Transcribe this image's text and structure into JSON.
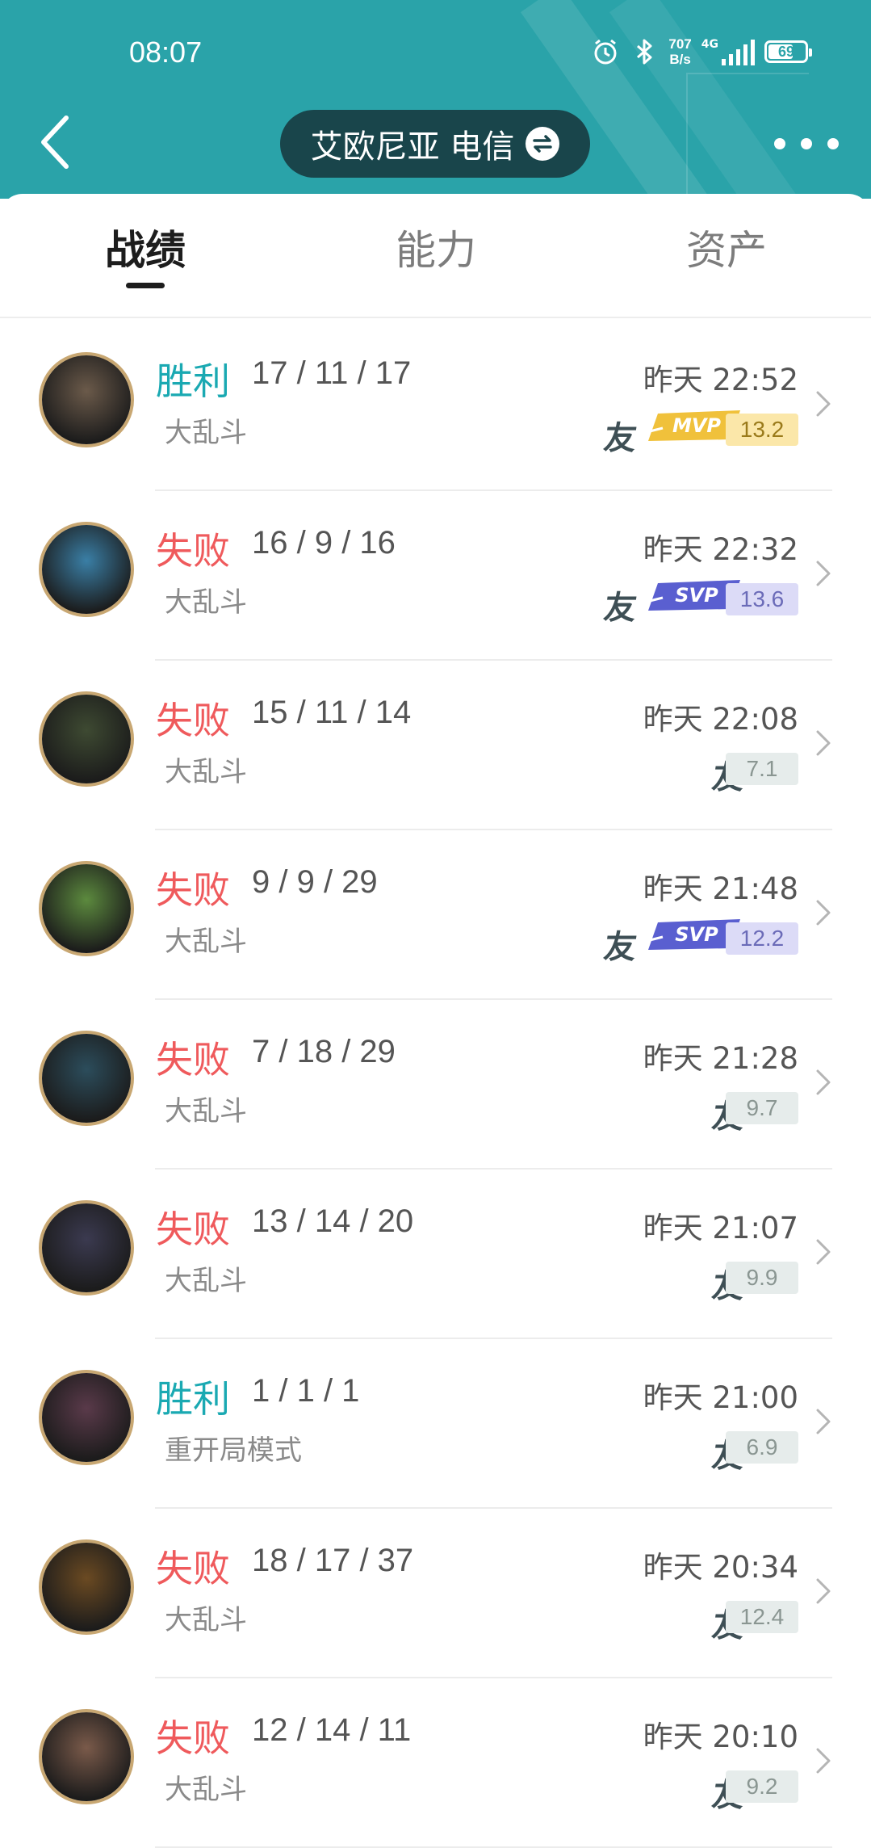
{
  "status_bar": {
    "time": "08:07",
    "speed_top": "707",
    "speed_bottom": "B/s",
    "network": "4G",
    "battery": "69",
    "battery_level": 0.69
  },
  "header": {
    "server_name": "艾欧尼亚 电信",
    "colors": {
      "bg": "#2aa3a9",
      "pill": "#19454b"
    }
  },
  "tabs": [
    {
      "label": "战绩",
      "active": true
    },
    {
      "label": "能力",
      "active": false
    },
    {
      "label": "资产",
      "active": false
    }
  ],
  "matches": [
    {
      "result": "胜利",
      "outcome": "win",
      "kda": "17 / 11 / 17",
      "time": "昨天 22:52",
      "mode": "大乱斗",
      "friend": "友",
      "badge": "MVP",
      "score": "13.2",
      "avatar_color": "#6b5a4a"
    },
    {
      "result": "失败",
      "outcome": "loss",
      "kda": "16 / 9 / 16",
      "time": "昨天 22:32",
      "mode": "大乱斗",
      "friend": "友",
      "badge": "SVP",
      "score": "13.6",
      "avatar_color": "#3a7fa6"
    },
    {
      "result": "失败",
      "outcome": "loss",
      "kda": "15 / 11 / 14",
      "time": "昨天 22:08",
      "mode": "大乱斗",
      "friend": "友",
      "badge": "",
      "score": "7.1",
      "avatar_color": "#3e4a32"
    },
    {
      "result": "失败",
      "outcome": "loss",
      "kda": "9 / 9 / 29",
      "time": "昨天 21:48",
      "mode": "大乱斗",
      "friend": "友",
      "badge": "SVP",
      "score": "12.2",
      "avatar_color": "#5c8a3e"
    },
    {
      "result": "失败",
      "outcome": "loss",
      "kda": "7 / 18 / 29",
      "time": "昨天 21:28",
      "mode": "大乱斗",
      "friend": "友",
      "badge": "",
      "score": "9.7",
      "avatar_color": "#2c4d5c"
    },
    {
      "result": "失败",
      "outcome": "loss",
      "kda": "13 / 14 / 20",
      "time": "昨天 21:07",
      "mode": "大乱斗",
      "friend": "友",
      "badge": "",
      "score": "9.9",
      "avatar_color": "#3b3a50"
    },
    {
      "result": "胜利",
      "outcome": "win",
      "kda": "1 / 1 / 1",
      "time": "昨天 21:00",
      "mode": "重开局模式",
      "friend": "友",
      "badge": "",
      "score": "6.9",
      "avatar_color": "#5a3a4a"
    },
    {
      "result": "失败",
      "outcome": "loss",
      "kda": "18 / 17 / 37",
      "time": "昨天 20:34",
      "mode": "大乱斗",
      "friend": "友",
      "badge": "",
      "score": "12.4",
      "avatar_color": "#6b4a22"
    },
    {
      "result": "失败",
      "outcome": "loss",
      "kda": "12 / 14 / 11",
      "time": "昨天 20:10",
      "mode": "大乱斗",
      "friend": "友",
      "badge": "",
      "score": "9.2",
      "avatar_color": "#7a5a4a"
    }
  ],
  "colors": {
    "win": "#1aa9b2",
    "loss": "#ef5a5c",
    "mvp": "#f0c13b",
    "svp": "#5a5fd0",
    "score_mvp_bg": "#fbe7a9",
    "score_mvp_fg": "#9a7a1a",
    "score_svp_bg": "#dcdbf7",
    "score_svp_fg": "#6b6bb8",
    "score_bg": "#e6eceb",
    "score_fg": "#8a9692"
  }
}
